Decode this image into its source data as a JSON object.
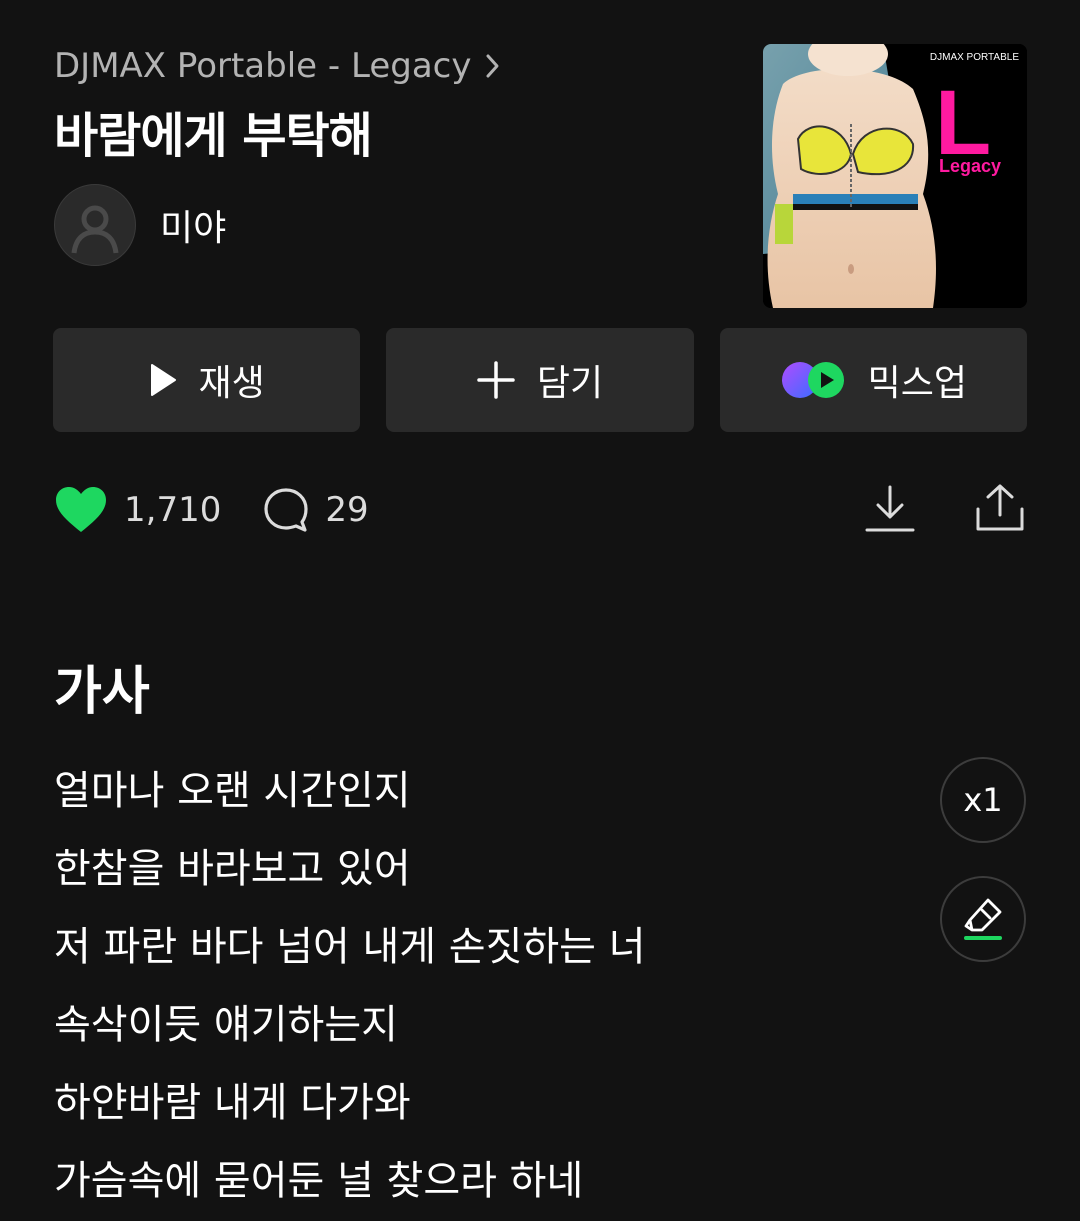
{
  "album": {
    "name": "DJMAX Portable - Legacy",
    "cover_text_top": "DJMAX PORTABLE",
    "cover_letter": "L",
    "cover_subtitle": "Legacy"
  },
  "song": {
    "title": "바람에게 부탁해"
  },
  "artist": {
    "name": "미야"
  },
  "actions": {
    "play_label": "재생",
    "add_label": "담기",
    "mixup_label": "믹스업"
  },
  "stats": {
    "likes": "1,710",
    "comments": "29"
  },
  "lyrics": {
    "heading": "가사",
    "speed_label": "x1",
    "lines": [
      "얼마나 오랜 시간인지",
      "한참을 바라보고 있어",
      "저 파란 바다 넘어 내게 손짓하는 너",
      "속삭이듯 얘기하는지",
      "하얀바람 내게 다가와",
      "가슴속에 묻어둔 널 찾으라 하네"
    ]
  },
  "colors": {
    "background": "#121212",
    "button_bg": "#2a2a2a",
    "like_green": "#1ed760",
    "muted_text": "#b3b3b3",
    "cover_pink": "#ff1aa0"
  },
  "icons": [
    "chevron-right-icon",
    "user-placeholder-icon",
    "play-icon",
    "plus-icon",
    "mixup-icon",
    "heart-icon",
    "comment-icon",
    "download-icon",
    "share-icon",
    "highlighter-icon"
  ]
}
